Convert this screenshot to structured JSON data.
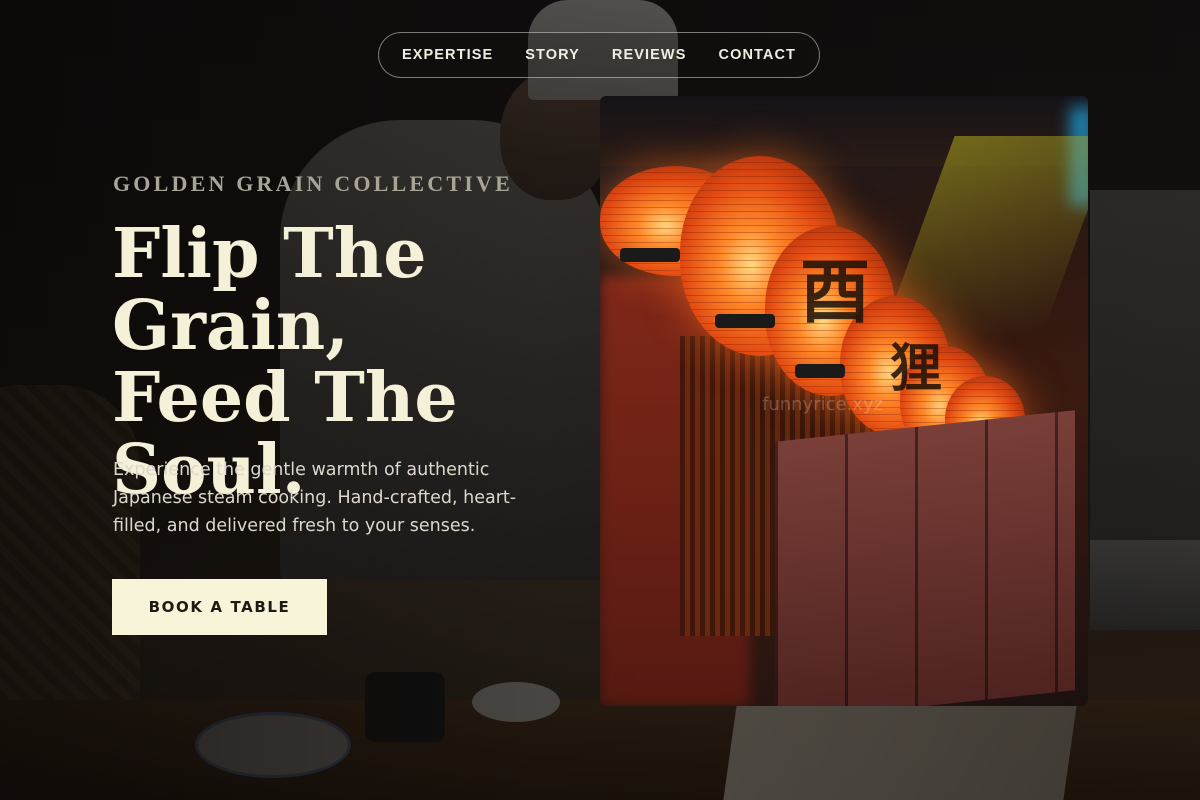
{
  "nav": {
    "items": [
      {
        "label": "EXPERTISE"
      },
      {
        "label": "STORY"
      },
      {
        "label": "REVIEWS"
      },
      {
        "label": "CONTACT"
      }
    ]
  },
  "hero": {
    "eyebrow": "GOLDEN GRAIN COLLECTIVE",
    "headline": [
      "Flip The",
      "Grain,",
      "Feed The Soul."
    ],
    "description": "Experience the gentle warmth of authentic Japanese steam cooking. Hand-crafted, heart-filled, and delivered fresh to your senses.",
    "cta_label": "BOOK A TABLE"
  },
  "feature_image": {
    "watermark": "funnyrice.xyz",
    "icon": "lantern-street-photo"
  },
  "colors": {
    "accent_cream": "#f7f4d9",
    "headline": "#f5f0d8",
    "eyebrow": "#a9a398"
  }
}
